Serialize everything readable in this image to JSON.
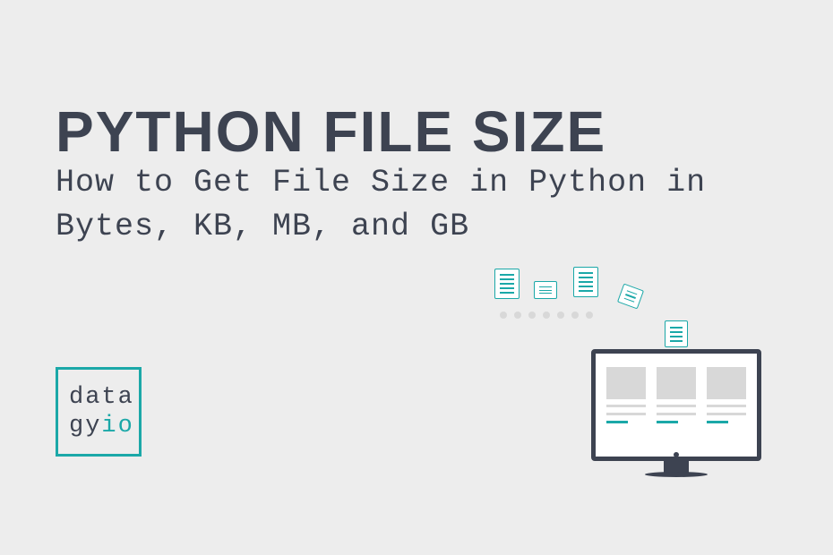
{
  "title": "PYTHON FILE SIZE",
  "subtitle": "How to Get File Size in Python in Bytes, KB, MB, and GB",
  "logo": {
    "line1": "data",
    "line2a": "gy",
    "line2b": "io"
  }
}
